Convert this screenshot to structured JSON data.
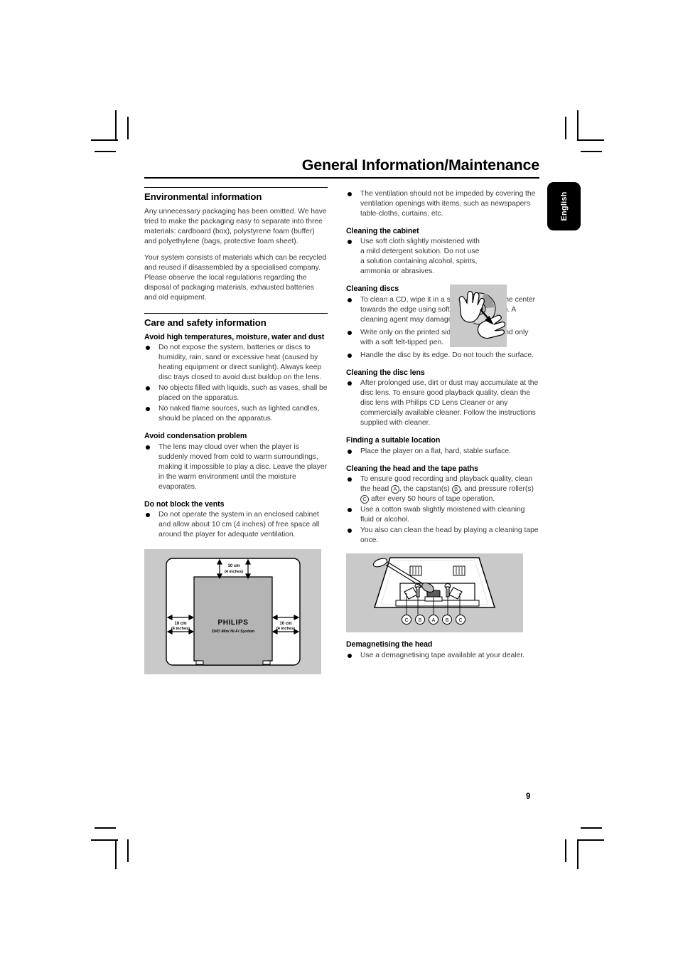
{
  "document": {
    "title": "General Information/Maintenance",
    "page_number": "9",
    "language_tab": "English"
  },
  "left_column": {
    "environmental": {
      "heading": "Environmental information",
      "paragraphs": [
        "Any unnecessary packaging has been omitted. We have tried to make the packaging easy to separate into three materials: cardboard (box), polystyrene foam (buffer) and polyethylene (bags, protective foam sheet).",
        "Your system consists of materials which can be recycled and reused if disassembled by a specialised company. Please observe the local regulations regarding the disposal of packaging materials, exhausted batteries and old equipment."
      ]
    },
    "care_safety": {
      "heading": "Care and safety information",
      "subsections": [
        {
          "subheading": "Avoid high temperatures, moisture, water and dust",
          "bullets": [
            "Do not expose the system, batteries or discs to humidity, rain, sand or excessive heat (caused by heating equipment or direct sunlight). Always keep disc trays closed to avoid dust buildup on the lens.",
            "No objects filled with liquids, such as vases, shall be placed on the apparatus.",
            "No naked flame sources, such as lighted candles, should be placed on the apparatus."
          ]
        },
        {
          "subheading": "Avoid condensation problem",
          "bullets": [
            "The lens may cloud over when the player is suddenly moved from cold to warm surroundings, making it impossible to play a disc. Leave the player in the warm environment until the moisture evaporates."
          ]
        },
        {
          "subheading": "Do not block the vents",
          "bullets": [
            "Do not operate the system in an enclosed cabinet and allow about 10 cm (4 inches) of free space all around the player for adequate ventilation."
          ]
        }
      ]
    },
    "room_figure": {
      "top_label_line1": "10 cm",
      "top_label_line2": "(4 inches)",
      "left_label_line1": "10 cm",
      "left_label_line2": "(4 inches)",
      "right_label_line1": "10 cm",
      "right_label_line2": "(4 inches)",
      "brand": "PHILIPS",
      "model": "DVD Mini Hi-Fi System"
    }
  },
  "right_column": {
    "ventilation_bullet": "The ventilation should not be impeded by covering the ventilation openings with items, such as newspapers table-cloths, curtains, etc.",
    "cleaning_cabinet": {
      "subheading": "Cleaning the cabinet",
      "bullets": [
        "Use soft cloth slightly moistened with a mild detergent solution. Do not use a solution containing alcohol, spirits, ammonia or abrasives."
      ]
    },
    "cleaning_discs": {
      "subheading": "Cleaning discs",
      "bullets": [
        "To clean a CD, wipe it in a straight line from the center towards the edge using soft and lint-free cloth. A cleaning agent may damage the disc.",
        "Write only on the printed side of a CDR(W) and only with a soft felt-tipped pen.",
        "Handle the disc by its edge. Do not touch the surface."
      ]
    },
    "cleaning_disc_lens": {
      "subheading": "Cleaning the disc lens",
      "bullets": [
        "After prolonged use, dirt or dust may accumulate at the disc lens. To ensure good playback quality, clean the disc lens with Philips CD Lens Cleaner or any commercially available cleaner. Follow the instructions supplied with cleaner."
      ]
    },
    "finding_location": {
      "subheading": "Finding a suitable location",
      "bullets": [
        "Place the player on a flat, hard, stable surface."
      ]
    },
    "cleaning_head": {
      "subheading": "Cleaning the head and the tape paths",
      "bullet_head_parts": {
        "text_1": "To ensure good recording and playback quality, clean the head ",
        "mark_a": "A",
        "text_2": ", the capstan(s) ",
        "mark_b": "B",
        "text_3": ", and pressure roller(s) ",
        "mark_c": "C",
        "text_4": " after every 50 hours of tape operation."
      },
      "bullets": [
        "Use a cotton swab slightly moistened with cleaning fluid or alcohol.",
        "You also can clean the head  by playing a cleaning tape once."
      ]
    },
    "tape_figure": {
      "labels": [
        "C",
        "B",
        "A",
        "B",
        "C"
      ]
    },
    "demagnetising": {
      "subheading": "Demagnetising the head",
      "bullets": [
        "Use a demagnetising tape available at your dealer."
      ]
    }
  },
  "colors": {
    "figure_background": "#c9c9c9",
    "body_text": "#3a3a3a",
    "tab_background": "#000000"
  }
}
